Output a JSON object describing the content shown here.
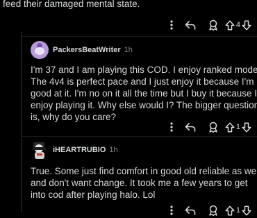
{
  "top_comment": {
    "text_tail": "feed their damaged mental state.",
    "vote_count": "4"
  },
  "comments": [
    {
      "username": "PackersBeatWriter",
      "age": "1h",
      "lines": [
        "I'm 37 and I am playing this COD. I enjoy ranked mode.",
        "The 4v4 is perfect pace and I just enjoy it because I'm",
        "good at it. I'm no on it all the time but I buy it because I",
        "enjoy playing it. Why else would I? The bigger question",
        "is, why do you care?"
      ],
      "vote_count": "1"
    },
    {
      "username": "iHEARTRUBIO",
      "age": "1h",
      "lines": [
        "True. Some just find comfort in good old reliable as well",
        "and don't want change. It took me a few years to get",
        "into cod after playing halo. Lol"
      ],
      "vote_count": "1"
    }
  ],
  "icons": [
    "more-options-icon",
    "reply-icon",
    "award-icon",
    "upvote-icon",
    "downvote-icon"
  ]
}
